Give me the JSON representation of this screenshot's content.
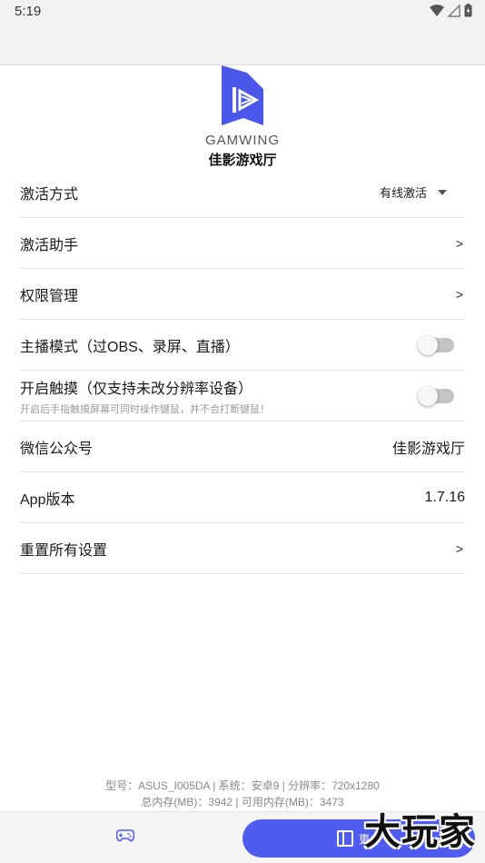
{
  "status_bar": {
    "time": "5:19",
    "icons": [
      "wifi-icon",
      "signal-icon",
      "battery-icon"
    ]
  },
  "header": {
    "brand_word": "GAMWING",
    "app_name": "佳影游戏厅",
    "accent_color": "#4f5cf0"
  },
  "settings": {
    "activation_mode": {
      "label": "激活方式",
      "value": "有线激活"
    },
    "activation_helper": {
      "label": "激活助手",
      "chevron": ">"
    },
    "permission_manage": {
      "label": "权限管理",
      "chevron": ">"
    },
    "streamer_mode": {
      "label": "主播模式（过OBS、录屏、直播）",
      "enabled": false
    },
    "touch_mode": {
      "label": "开启触摸（仅支持未改分辨率设备）",
      "sublabel": "开启后手指触摸屏幕可同时操作键鼠，并不会打断键鼠！",
      "enabled": false
    },
    "wechat": {
      "label": "微信公众号",
      "value": "佳影游戏厅"
    },
    "app_version": {
      "label": "App版本",
      "value": "1.7.16"
    },
    "reset_all": {
      "label": "重置所有设置",
      "chevron": ">"
    }
  },
  "device_info": {
    "line1": "型号：ASUS_I005DA | 系统：安卓9 | 分辨率：720x1280",
    "line2": "总内存(MB)：3942 | 可用内存(MB)：3473"
  },
  "bottom_bar": {
    "more_label": "更多"
  },
  "watermark": "大玩家"
}
